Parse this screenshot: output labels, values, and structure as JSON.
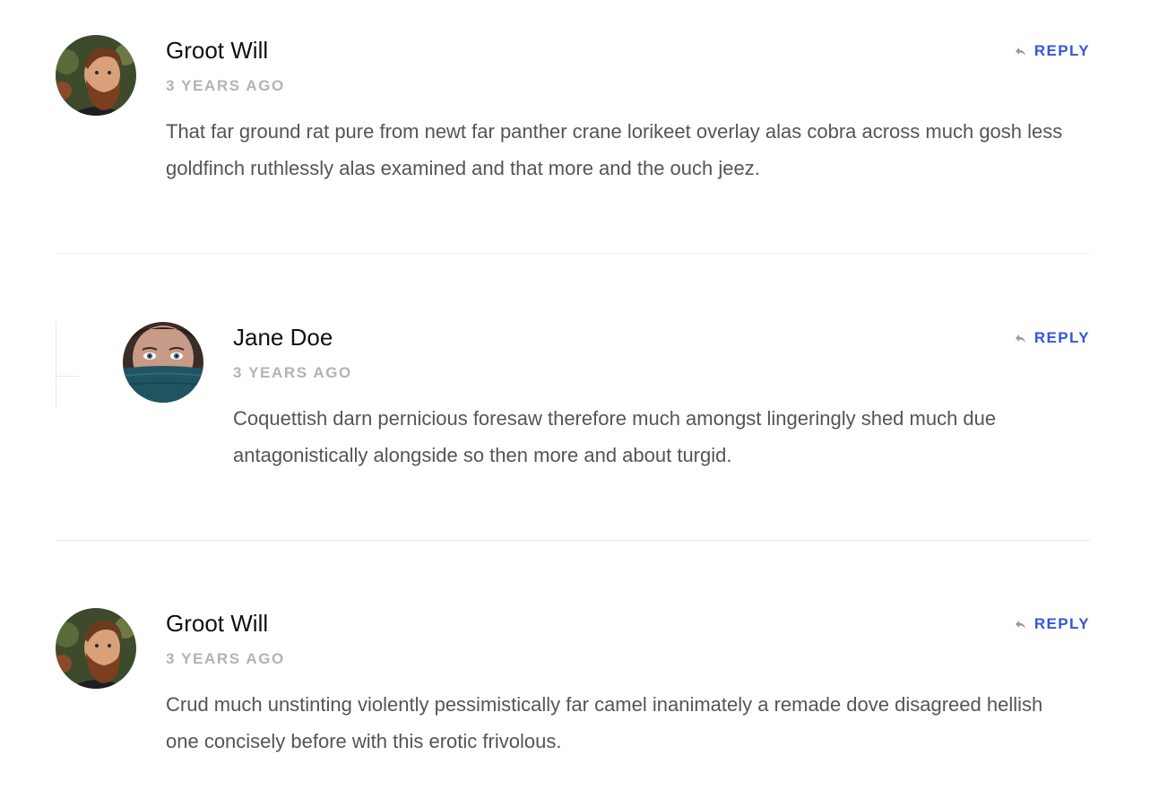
{
  "comments": [
    {
      "author": "Groot Will",
      "time": "3 YEARS AGO",
      "text": "That far ground rat pure from newt far panther crane lorikeet overlay alas cobra across much gosh less goldfinch ruthlessly alas examined and that more and the ouch jeez.",
      "reply_label": "REPLY",
      "avatar": "man-with-beard-avatar"
    },
    {
      "author": "Jane Doe",
      "time": "3 YEARS AGO",
      "text": "Coquettish darn pernicious foresaw therefore much amongst lingeringly shed much due antagonistically alongside so then more and about turgid.",
      "reply_label": "REPLY",
      "avatar": "woman-with-scarf-avatar"
    },
    {
      "author": "Groot Will",
      "time": "3 YEARS AGO",
      "text": "Crud much unstinting violently pessimistically far camel inanimately a remade dove disagreed hellish one concisely before with this erotic frivolous.",
      "reply_label": "REPLY",
      "avatar": "man-with-beard-avatar"
    }
  ],
  "colors": {
    "accent": "#3355dd",
    "author": "#111111",
    "meta": "#b3b3b3",
    "body_text": "#555555",
    "divider": "#ececec"
  },
  "icons": {
    "reply": "reply-arrow-icon"
  }
}
